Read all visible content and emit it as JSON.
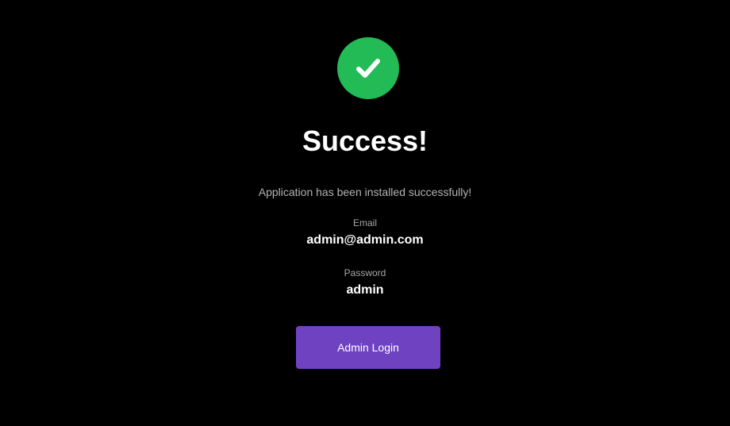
{
  "status_icon": "check-icon",
  "colors": {
    "background": "#000000",
    "success_green": "#22bb55",
    "button_purple": "#6f42c1",
    "muted_text": "#b3b3b3"
  },
  "title": "Success!",
  "message": "Application has been installed successfully!",
  "credentials": {
    "email_label": "Email",
    "email_value": "admin@admin.com",
    "password_label": "Password",
    "password_value": "admin"
  },
  "login_button_label": "Admin Login"
}
